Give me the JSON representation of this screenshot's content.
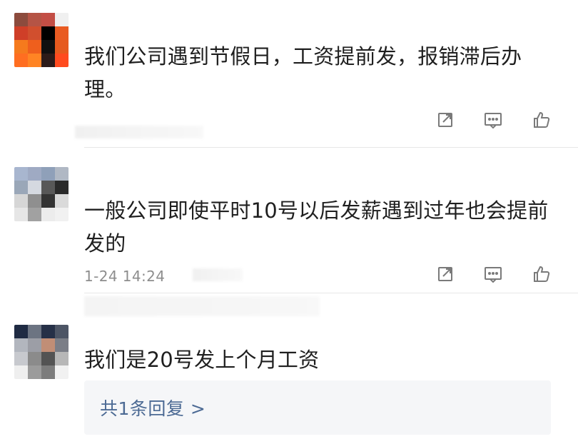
{
  "colors": {
    "text_primary": "#1f1f1f",
    "text_secondary": "#8d8d8d",
    "icon_gray": "#7a7a7a",
    "link_blue": "#4c6a94",
    "reply_bg": "#f5f6f8",
    "divider": "#e7e7e7"
  },
  "comments": [
    {
      "avatar": "blurred-avatar",
      "username": "",
      "text": "我们公司遇到节假日，工资提前发，报销滞后办理。",
      "timestamp": "",
      "actions": {
        "share_icon": "share-icon",
        "reply_icon": "reply-icon",
        "like_icon": "like-icon"
      }
    },
    {
      "avatar": "blurred-avatar",
      "username": "",
      "text": "一般公司即使平时10号以后发薪遇到过年也会提前发的",
      "timestamp": "1-24 14:24",
      "actions": {
        "share_icon": "share-icon",
        "reply_icon": "reply-icon",
        "like_icon": "like-icon"
      }
    },
    {
      "avatar": "blurred-avatar",
      "username": "",
      "text": "我们是20号发上个月工资",
      "timestamp": "",
      "reply_summary": "共1条回复 >"
    }
  ]
}
